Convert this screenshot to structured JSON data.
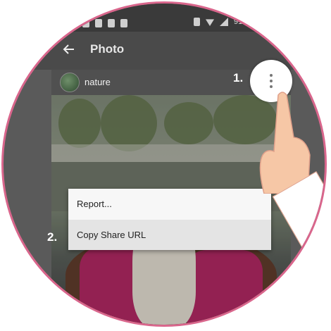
{
  "status_bar": {
    "battery_text": "91"
  },
  "app_bar": {
    "title": "Photo"
  },
  "post": {
    "username": "nature"
  },
  "context_menu": {
    "items": [
      {
        "label": "Report..."
      },
      {
        "label": "Copy Share URL"
      }
    ]
  },
  "steps": {
    "step1": "1.",
    "step2": "2."
  },
  "colors": {
    "frame_border": "#d9668c",
    "status_bar_bg": "#3a3a3a",
    "app_bar_bg": "#4a4a4a",
    "menu_bg": "#f7f7f7",
    "menu_highlight": "#e4e4e4"
  },
  "icons": [
    "back-arrow-icon",
    "more-vert-icon",
    "wifi-icon",
    "signal-icon",
    "mute-icon"
  ]
}
